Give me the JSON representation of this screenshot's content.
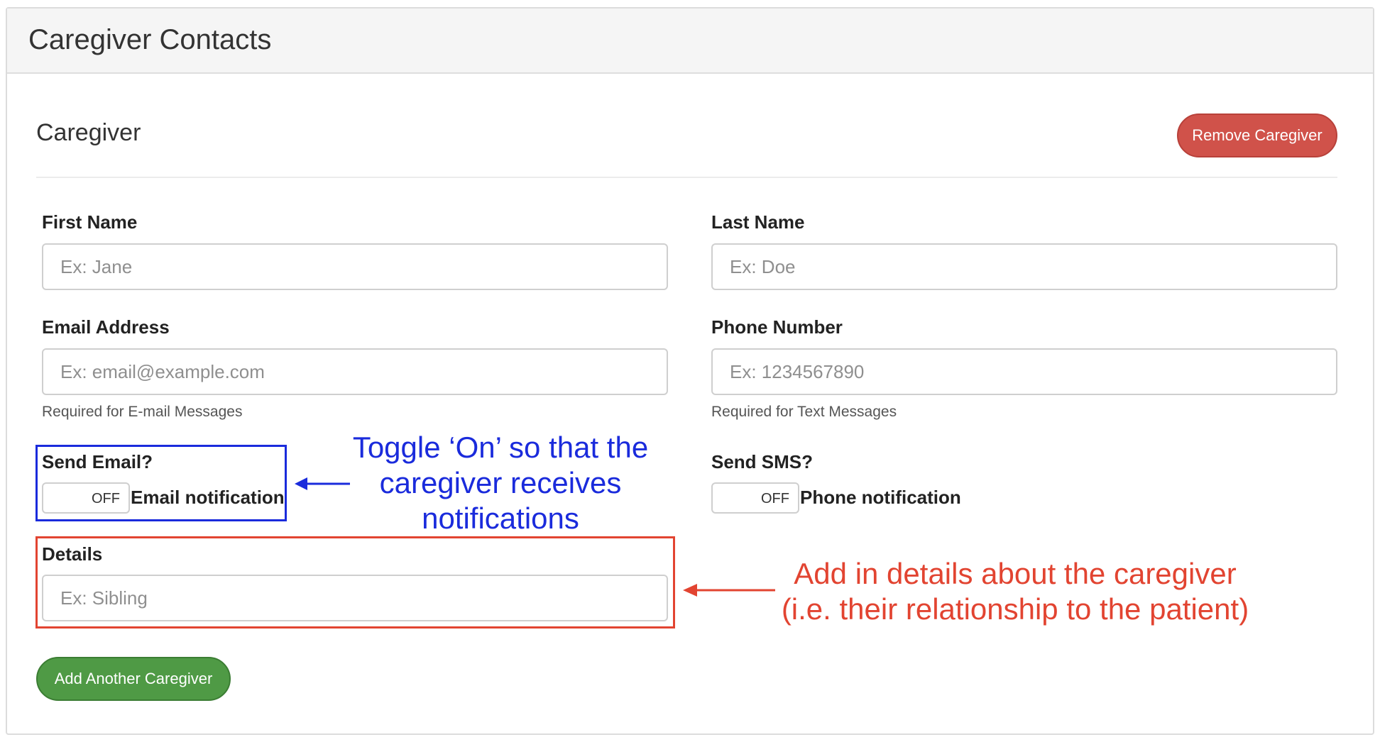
{
  "panel": {
    "title": "Caregiver Contacts"
  },
  "section": {
    "title": "Caregiver",
    "remove_label": "Remove Caregiver"
  },
  "fields": {
    "first_name": {
      "label": "First Name",
      "placeholder": "Ex: Jane",
      "value": ""
    },
    "last_name": {
      "label": "Last Name",
      "placeholder": "Ex: Doe",
      "value": ""
    },
    "email": {
      "label": "Email Address",
      "placeholder": "Ex: email@example.com",
      "value": "",
      "help": "Required for E-mail Messages"
    },
    "phone": {
      "label": "Phone Number",
      "placeholder": "Ex: 1234567890",
      "value": "",
      "help": "Required for Text Messages"
    },
    "details": {
      "label": "Details",
      "placeholder": "Ex: Sibling",
      "value": ""
    }
  },
  "toggles": {
    "send_email": {
      "label": "Send Email?",
      "state": "OFF",
      "text": "Email notification"
    },
    "send_sms": {
      "label": "Send SMS?",
      "state": "OFF",
      "text": "Phone notification"
    }
  },
  "add_label": "Add Another Caregiver",
  "annotations": {
    "toggle_note": {
      "line1": "Toggle ‘On’ so that the",
      "line2": "caregiver receives",
      "line3": "notifications",
      "color": "#1a2bdc"
    },
    "details_note": {
      "line1": "Add in details about the caregiver",
      "line2": "(i.e. their relationship to the patient)",
      "color": "#e24431"
    }
  }
}
